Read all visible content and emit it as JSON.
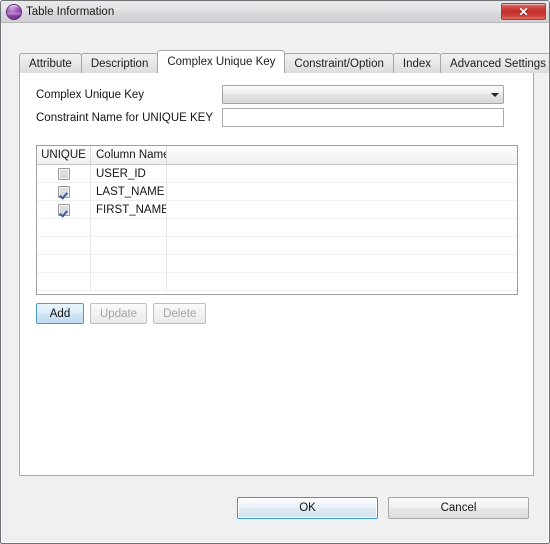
{
  "window": {
    "title": "Table Information",
    "icon": "purple-sphere-icon",
    "close_label": "✕"
  },
  "theme": {
    "window_bg": "#f0f0f0",
    "panel_bg": "#ffffff",
    "accent_blue": "#3c97d4",
    "close_red": "#c2302c",
    "icon_purple": "#9b4eb5",
    "check_blue": "#3a5a9b",
    "disabled_text": "#a5a5a5"
  },
  "tabs": [
    {
      "label": "Attribute",
      "active": false
    },
    {
      "label": "Description",
      "active": false
    },
    {
      "label": "Complex Unique Key",
      "active": true
    },
    {
      "label": "Constraint/Option",
      "active": false
    },
    {
      "label": "Index",
      "active": false
    },
    {
      "label": "Advanced Settings",
      "active": false
    }
  ],
  "form": {
    "complex_unique_key": {
      "label": "Complex Unique Key",
      "selected_value": "",
      "placeholder": "",
      "options": []
    },
    "constraint_name": {
      "label": "Constraint Name for UNIQUE KEY",
      "value": "",
      "placeholder": ""
    }
  },
  "grid": {
    "columns": [
      "UNIQUE",
      "Column Name",
      ""
    ],
    "rows": [
      {
        "unique": false,
        "column_name": "USER_ID",
        "extra": ""
      },
      {
        "unique": true,
        "column_name": "LAST_NAME",
        "extra": ""
      },
      {
        "unique": true,
        "column_name": "FIRST_NAME",
        "extra": ""
      },
      {
        "unique": null,
        "column_name": "",
        "extra": ""
      },
      {
        "unique": null,
        "column_name": "",
        "extra": ""
      },
      {
        "unique": null,
        "column_name": "",
        "extra": ""
      },
      {
        "unique": null,
        "column_name": "",
        "extra": ""
      }
    ]
  },
  "row_buttons": {
    "add": {
      "label": "Add",
      "enabled": true
    },
    "update": {
      "label": "Update",
      "enabled": false
    },
    "delete": {
      "label": "Delete",
      "enabled": false
    }
  },
  "footer": {
    "ok": "OK",
    "cancel": "Cancel"
  }
}
